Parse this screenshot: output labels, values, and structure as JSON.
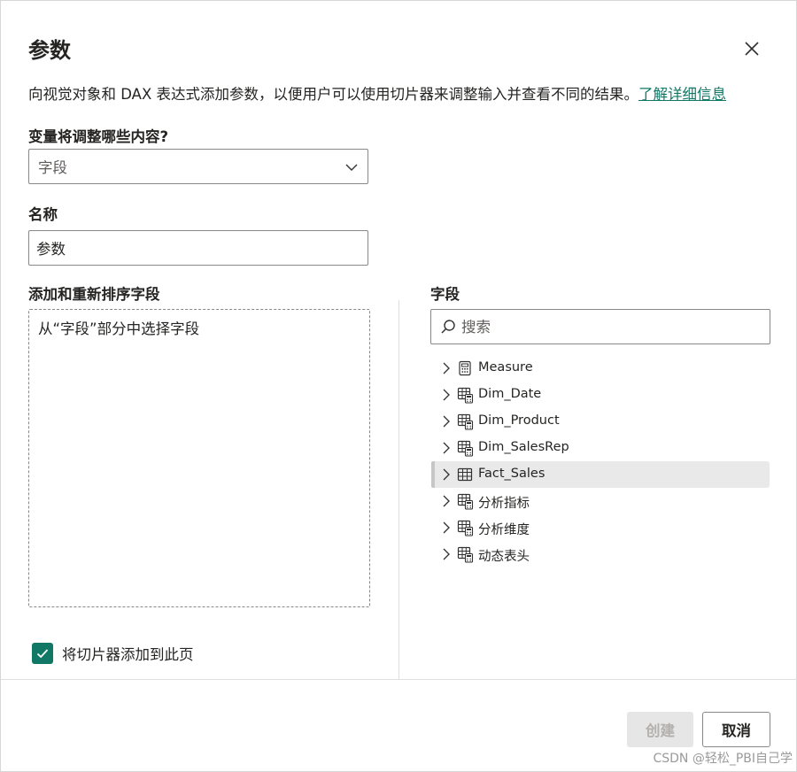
{
  "dialog": {
    "title": "参数",
    "description": "向视觉对象和 DAX 表达式添加参数，以便用户可以使用切片器来调整输入并查看不同的结果。",
    "learn_more": "了解详细信息"
  },
  "variable": {
    "label": "变量将调整哪些内容?",
    "selected": "字段"
  },
  "name": {
    "label": "名称",
    "value": "参数"
  },
  "reorder": {
    "label": "添加和重新排序字段",
    "placeholder": "从“字段”部分中选择字段"
  },
  "fields": {
    "label": "字段",
    "search_placeholder": "搜索",
    "items": [
      {
        "label": "Measure",
        "icon": "calculator-icon",
        "selected": false
      },
      {
        "label": "Dim_Date",
        "icon": "table-calc-icon",
        "selected": false
      },
      {
        "label": "Dim_Product",
        "icon": "table-calc-icon",
        "selected": false
      },
      {
        "label": "Dim_SalesRep",
        "icon": "table-calc-icon",
        "selected": false
      },
      {
        "label": "Fact_Sales",
        "icon": "table-icon",
        "selected": true
      },
      {
        "label": "分析指标",
        "icon": "table-calc-icon",
        "selected": false
      },
      {
        "label": "分析维度",
        "icon": "table-calc-icon",
        "selected": false
      },
      {
        "label": "动态表头",
        "icon": "table-calc-icon",
        "selected": false
      }
    ]
  },
  "slicer_checkbox": {
    "label": "将切片器添加到此页",
    "checked": true
  },
  "buttons": {
    "create": "创建",
    "cancel": "取消"
  },
  "watermark": "CSDN @轻松_PBI自己学",
  "colors": {
    "accent": "#117865",
    "text": "#252423",
    "border": "#8a8886",
    "selected_bg": "#e9e9e9"
  }
}
